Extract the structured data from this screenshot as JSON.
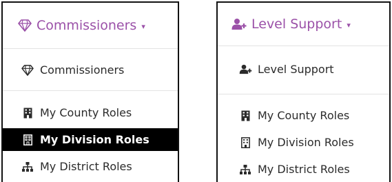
{
  "left_panel": {
    "toggle_label": "Commissioners",
    "caret": "▾",
    "items": [
      {
        "label": "Commissioners",
        "icon": "diamond-icon"
      },
      {
        "label": "My County Roles",
        "icon": "building-icon"
      },
      {
        "label": "My Division Roles",
        "icon": "building-icon",
        "active": true
      },
      {
        "label": "My District Roles",
        "icon": "sitemap-icon"
      }
    ]
  },
  "right_panel": {
    "toggle_label": "Level Support",
    "caret": "▾",
    "items": [
      {
        "label": "Level Support",
        "icon": "user-plus-icon"
      },
      {
        "label": "My County Roles",
        "icon": "building-icon"
      },
      {
        "label": "My Division Roles",
        "icon": "building-outline-icon"
      },
      {
        "label": "My District Roles",
        "icon": "sitemap-icon"
      }
    ]
  },
  "colors": {
    "accent": "#9b51a8",
    "text": "#2b2b2b",
    "active_bg": "#000000",
    "active_text": "#ffffff",
    "border": "#111111"
  }
}
